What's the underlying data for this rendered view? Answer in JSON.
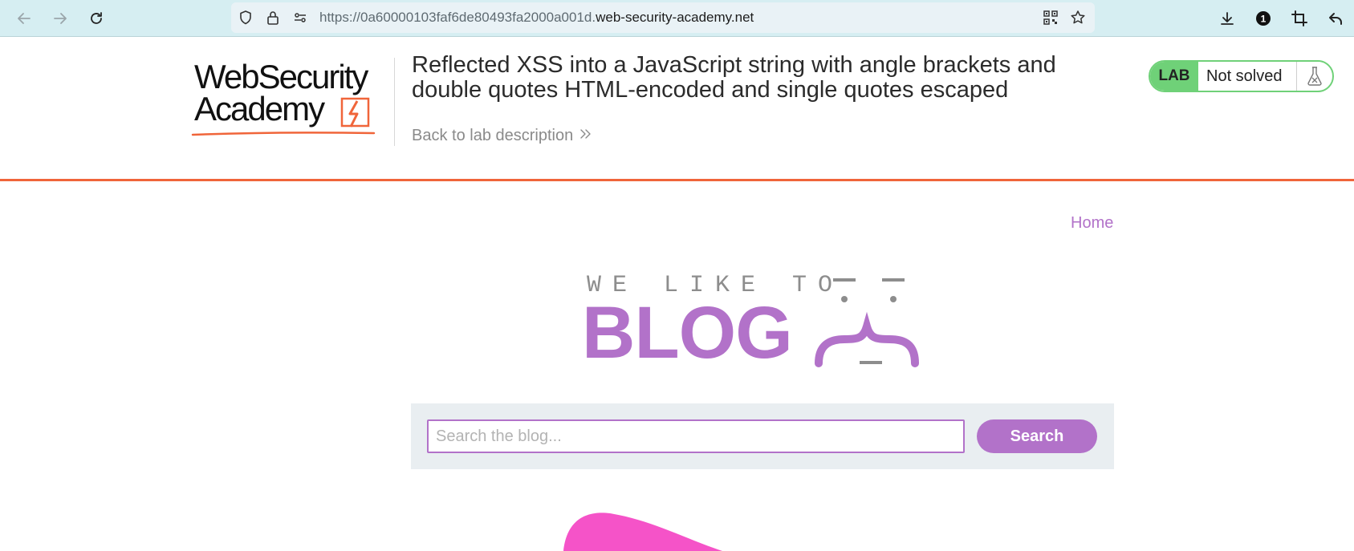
{
  "browser": {
    "url_prefix": "https://0a60000103faf6de80493fa2000a001d.",
    "url_host": "web-security-academy.net",
    "notification_count": "1"
  },
  "lab": {
    "logo_line1": "WebSecurity",
    "logo_line2": "Academy",
    "title": "Reflected XSS into a JavaScript string with angle brackets and double quotes HTML-encoded and single quotes escaped",
    "back_link": "Back to lab description",
    "status_tag": "LAB",
    "status_text": "Not solved"
  },
  "blog": {
    "home_link": "Home",
    "tagline": "WE LIKE TO",
    "wordmark": "BLOG",
    "search_placeholder": "Search the blog...",
    "search_value": "",
    "search_button": "Search"
  },
  "colors": {
    "accent": "#b272c9",
    "header_rule": "#f0653a",
    "lab_badge": "#6fd178",
    "browser_bar": "#d6eef2"
  },
  "icons": [
    "back-arrow-icon",
    "forward-arrow-icon",
    "reload-icon",
    "shield-icon",
    "lock-icon",
    "permissions-icon",
    "qr-code-icon",
    "bookmark-star-icon",
    "download-icon",
    "extension-badge-icon",
    "crop-icon",
    "undo-arrow-icon",
    "double-chevron-icon",
    "flask-icon"
  ]
}
